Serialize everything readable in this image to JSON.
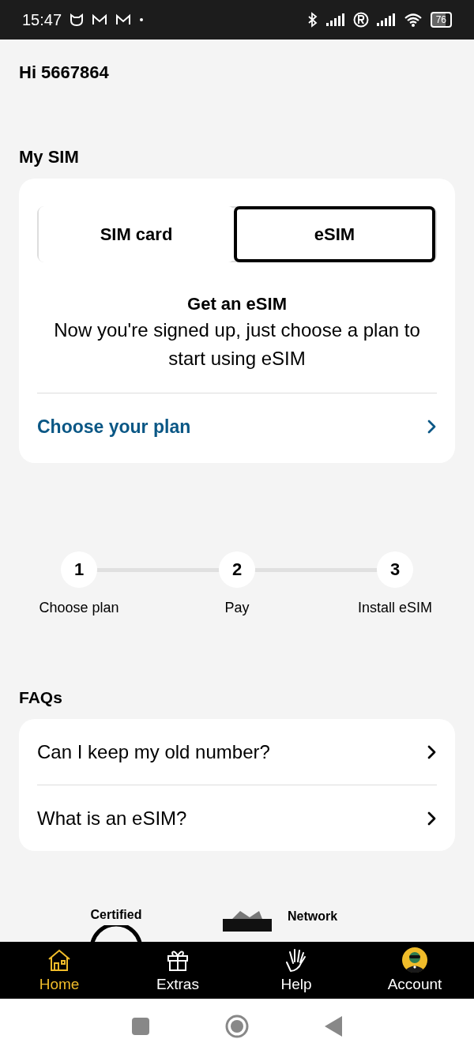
{
  "status_bar": {
    "time": "15:47",
    "battery": "76"
  },
  "greeting": "Hi 5667864",
  "my_sim": {
    "heading": "My SIM",
    "toggle": [
      {
        "label": "SIM card",
        "selected": false
      },
      {
        "label": "eSIM",
        "selected": true
      }
    ],
    "title": "Get an eSIM",
    "body": "Now you're signed up, just choose a plan to start using eSIM",
    "link": "Choose your plan"
  },
  "steps": [
    {
      "number": "1",
      "label": "Choose plan"
    },
    {
      "number": "2",
      "label": "Pay"
    },
    {
      "number": "3",
      "label": "Install eSIM"
    }
  ],
  "faqs": {
    "heading": "FAQs",
    "items": [
      "Can I keep my old number?",
      "What is an eSIM?"
    ]
  },
  "badges": [
    "Certified",
    "Network"
  ],
  "tabs": [
    {
      "label": "Home",
      "selected": true
    },
    {
      "label": "Extras",
      "selected": false
    },
    {
      "label": "Help",
      "selected": false
    },
    {
      "label": "Account",
      "selected": false
    }
  ]
}
